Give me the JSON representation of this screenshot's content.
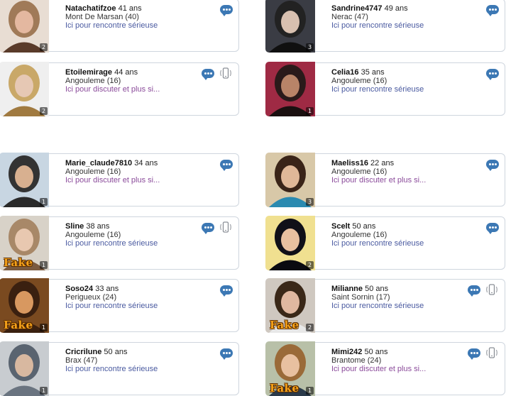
{
  "profiles": [
    {
      "username": "Natachatifzoe",
      "age": "41 ans",
      "location": "Mont De Marsan (40)",
      "tagline": "Ici pour rencontre sérieuse",
      "tag_type": "serious",
      "photo_count": "2",
      "fake": false,
      "phone": false,
      "colors": [
        "#e8ddd3",
        "#a07a58",
        "#5a3b2a",
        "#e4b8a0"
      ]
    },
    {
      "username": "Sandrine4747",
      "age": "49 ans",
      "location": "Nerac (47)",
      "tagline": "Ici pour rencontre sérieuse",
      "tag_type": "serious",
      "photo_count": "3",
      "fake": false,
      "phone": false,
      "colors": [
        "#3a3c44",
        "#222",
        "#101010",
        "#d8c0b0"
      ]
    },
    {
      "username": "Etoilemirage",
      "age": "44 ans",
      "location": "Angouleme (16)",
      "tagline": "Ici pour discuter et plus si...",
      "tag_type": "chat",
      "photo_count": "2",
      "fake": false,
      "phone": true,
      "colors": [
        "#efefef",
        "#c9a868",
        "#a07a40",
        "#e6c8b4"
      ]
    },
    {
      "username": "Celia16",
      "age": "35 ans",
      "location": "Angouleme (16)",
      "tagline": "Ici pour rencontre sérieuse",
      "tag_type": "serious",
      "photo_count": "1",
      "fake": false,
      "phone": false,
      "colors": [
        "#9f2a44",
        "#2a1a1a",
        "#1a1010",
        "#b88468"
      ]
    },
    {
      "username": "Marie_claude7810",
      "age": "34 ans",
      "location": "Angouleme (16)",
      "tagline": "Ici pour discuter et plus si...",
      "tag_type": "chat",
      "photo_count": "1",
      "fake": false,
      "phone": false,
      "colors": [
        "#c8d6e2",
        "#333",
        "#2a2a2a",
        "#d8b090"
      ]
    },
    {
      "username": "Maeliss16",
      "age": "22 ans",
      "location": "Angouleme (16)",
      "tagline": "Ici pour discuter et plus si...",
      "tag_type": "chat",
      "photo_count": "3",
      "fake": false,
      "phone": false,
      "colors": [
        "#d8c8a8",
        "#3a2418",
        "#2a8ab0",
        "#e0b898"
      ]
    },
    {
      "username": "Sline",
      "age": "38 ans",
      "location": "Angouleme (16)",
      "tagline": "Ici pour rencontre sérieuse",
      "tag_type": "serious",
      "photo_count": "1",
      "fake": true,
      "fake_label": "Fake",
      "phone": true,
      "colors": [
        "#d8d2c8",
        "#a88868",
        "#7a5a40",
        "#e8c8b0"
      ]
    },
    {
      "username": "Scelt",
      "age": "50 ans",
      "location": "Angouleme (16)",
      "tagline": "Ici pour rencontre sérieuse",
      "tag_type": "serious",
      "photo_count": "2",
      "fake": false,
      "phone": false,
      "colors": [
        "#f0e090",
        "#101018",
        "#0a0a10",
        "#e8c0a0"
      ]
    },
    {
      "username": "Soso24",
      "age": "33 ans",
      "location": "Perigueux (24)",
      "tagline": "Ici pour rencontre sérieuse",
      "tag_type": "serious",
      "photo_count": "1",
      "fake": true,
      "fake_label": "Fake",
      "phone": false,
      "colors": [
        "#7a4a20",
        "#3a2010",
        "#3a2010",
        "#d89860"
      ]
    },
    {
      "username": "Milianne",
      "age": "50 ans",
      "location": "Saint Sornin (17)",
      "tagline": "Ici pour rencontre sérieuse",
      "tag_type": "serious",
      "photo_count": "2",
      "fake": true,
      "fake_label": "Fake",
      "phone": true,
      "colors": [
        "#cfc8c0",
        "#3a2818",
        "#e8e8e8",
        "#e0b8a0"
      ]
    },
    {
      "username": "Cricrilune",
      "age": "50 ans",
      "location": "Brax (47)",
      "tagline": "Ici pour rencontre sérieuse",
      "tag_type": "serious",
      "photo_count": "1",
      "fake": false,
      "phone": false,
      "colors": [
        "#c8ccd0",
        "#5a6470",
        "#6a7480",
        "#d8b8a0"
      ]
    },
    {
      "username": "Mimi242",
      "age": "50 ans",
      "location": "Brantome (24)",
      "tagline": "Ici pour discuter et plus si...",
      "tag_type": "chat",
      "photo_count": "1",
      "fake": true,
      "fake_label": "Fake",
      "phone": true,
      "colors": [
        "#b8c0a8",
        "#9a6a38",
        "#2a3a4a",
        "#e8c0a0"
      ]
    }
  ]
}
